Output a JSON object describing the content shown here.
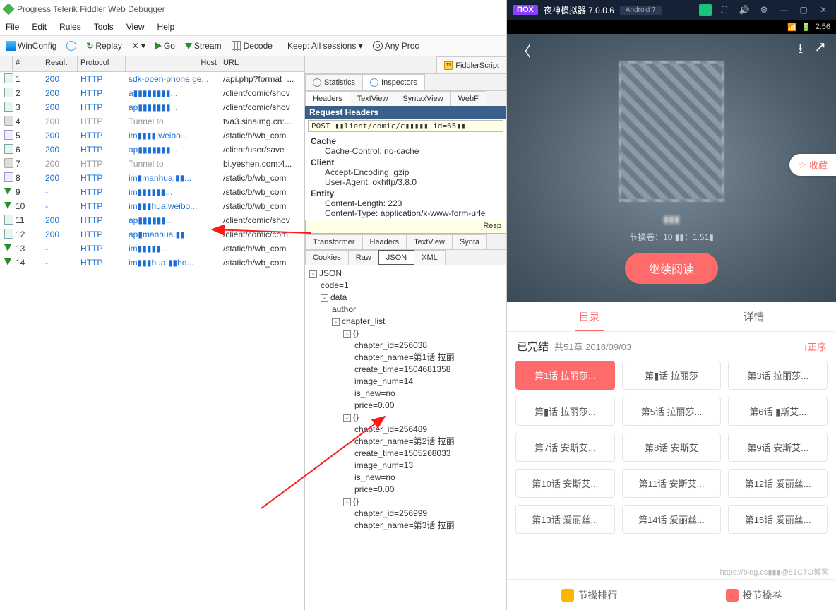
{
  "fiddler": {
    "title": "Progress Telerik Fiddler Web Debugger",
    "menu": [
      "File",
      "Edit",
      "Rules",
      "Tools",
      "View",
      "Help"
    ],
    "toolbar": {
      "winconfig": "WinConfig",
      "replay": "Replay",
      "x": "✕",
      "dd": "▾",
      "go": "Go",
      "stream": "Stream",
      "decode": "Decode",
      "keep": "Keep: All sessions ▾",
      "anyproc": "Any Proc"
    },
    "cols": {
      "id": "#",
      "result": "Result",
      "protocol": "Protocol",
      "host": "Host",
      "url": "URL"
    },
    "rows": [
      {
        "ic": "doc",
        "id": "1",
        "res": "200",
        "pro": "HTTP",
        "host": "sdk-open-phone.ge...",
        "url": "/api.php?format=...",
        "cls": ""
      },
      {
        "ic": "doc",
        "id": "2",
        "res": "200",
        "pro": "HTTP",
        "host": "a▮▮▮▮▮▮▮▮...",
        "url": "/client/comic/shov",
        "cls": ""
      },
      {
        "ic": "doc",
        "id": "3",
        "res": "200",
        "pro": "HTTP",
        "host": "ap▮▮▮▮▮▮▮...",
        "url": "/client/comic/shov",
        "cls": ""
      },
      {
        "ic": "lock",
        "id": "4",
        "res": "200",
        "pro": "HTTP",
        "host": "Tunnel to",
        "url": "tva3.sinaimg.cn:...",
        "cls": "gray"
      },
      {
        "ic": "page",
        "id": "5",
        "res": "200",
        "pro": "HTTP",
        "host": "im▮▮▮▮.weibo....",
        "url": "/static/b/wb_com",
        "cls": ""
      },
      {
        "ic": "doc",
        "id": "6",
        "res": "200",
        "pro": "HTTP",
        "host": "ap▮▮▮▮▮▮▮...",
        "url": "/client/user/save",
        "cls": ""
      },
      {
        "ic": "lock",
        "id": "7",
        "res": "200",
        "pro": "HTTP",
        "host": "Tunnel to",
        "url": "bi.yeshen.com:4...",
        "cls": "gray"
      },
      {
        "ic": "page",
        "id": "8",
        "res": "200",
        "pro": "HTTP",
        "host": "im▮manhua.▮▮...",
        "url": "/static/b/wb_com",
        "cls": ""
      },
      {
        "ic": "arr",
        "id": "9",
        "res": "-",
        "pro": "HTTP",
        "host": "im▮▮▮▮▮▮...",
        "url": "/static/b/wb_com",
        "cls": ""
      },
      {
        "ic": "arr",
        "id": "10",
        "res": "-",
        "pro": "HTTP",
        "host": "im▮▮▮hua.weibo...",
        "url": "/static/b/wb_com",
        "cls": ""
      },
      {
        "ic": "doc",
        "id": "11",
        "res": "200",
        "pro": "HTTP",
        "host": "ap▮▮▮▮▮▮...",
        "url": "/client/comic/shov",
        "cls": ""
      },
      {
        "ic": "doc",
        "id": "12",
        "res": "200",
        "pro": "HTTP",
        "host": "ap▮manhua.▮▮...",
        "url": "/client/comic/com",
        "cls": ""
      },
      {
        "ic": "arr",
        "id": "13",
        "res": "-",
        "pro": "HTTP",
        "host": "im▮▮▮▮▮...",
        "url": "/static/b/wb_com",
        "cls": ""
      },
      {
        "ic": "arr",
        "id": "14",
        "res": "-",
        "pro": "HTTP",
        "host": "im▮▮▮hua.▮▮ho...",
        "url": "/static/b/wb_com",
        "cls": ""
      }
    ],
    "topTabs": {
      "script": "FiddlerScript",
      "stats": "Statistics",
      "insp": "Inspectors"
    },
    "reqTabs": [
      "Headers",
      "TextView",
      "SyntaxView",
      "WebF"
    ],
    "reqTitle": "Request Headers",
    "reqLine": "POST ▮▮lient/comic/c▮▮▮▮▮ id=65▮▮",
    "headers": {
      "Cache": "Cache",
      "cache": "Cache-Control: no-cache",
      "Client": "Client",
      "ae": "Accept-Encoding: gzip",
      "ua": "User-Agent: okhttp/3.8.0",
      "Entity": "Entity",
      "cl": "Content-Length: 223",
      "ct": "Content-Type: application/x-www-form-urle"
    },
    "respLabel": "Resp",
    "respTabs": [
      "Transformer",
      "Headers",
      "TextView",
      "Synta"
    ],
    "respTabs2": [
      "Cookies",
      "Raw",
      "JSON",
      "XML"
    ],
    "json": {
      "root": "JSON",
      "code": "code=1",
      "data": "data",
      "author": "author",
      "chlist": "chapter_list",
      "ch": [
        {
          "id": "chapter_id=256038",
          "name": "chapter_name=第1话 拉丽",
          "ct": "create_time=1504681358",
          "img": "image_num=14",
          "new": "is_new=no",
          "price": "price=0.00"
        },
        {
          "id": "chapter_id=256489",
          "name": "chapter_name=第2话 拉丽",
          "ct": "create_time=1505268033",
          "img": "image_num=13",
          "new": "is_new=no",
          "price": "price=0.00"
        },
        {
          "id": "chapter_id=256999",
          "name": "chapter_name=第3话 拉丽"
        }
      ]
    }
  },
  "nox": {
    "brand": "ΠOX",
    "title": "夜神模拟器 7.0.0.6",
    "android": "Android 7",
    "time": "2:56",
    "fav": "收藏",
    "stats": "节操卷：10   ▮▮：1.51▮",
    "read": "继续阅读",
    "tabA": "目录",
    "tabB": "详情",
    "done": "已完结",
    "meta": "共51章 2018/09/03",
    "sort": "↓正序",
    "chips": [
      "第1话 拉丽莎...",
      "第▮话 拉丽莎",
      "第3话 拉丽莎...",
      "第▮话 拉丽莎...",
      "第5话 拉丽莎...",
      "第6话 ▮斯艾...",
      "第7话 安斯艾...",
      "第8话 安斯艾",
      "第9话 安斯艾...",
      "第10话 安斯艾...",
      "第11话 安斯艾...",
      "第12话 爱丽丝...",
      "第13话 爱丽丝...",
      "第14话 爱丽丝...",
      "第15话 爱丽丝..."
    ],
    "bot": {
      "rank": "节操排行",
      "vote": "投节操卷"
    },
    "wm": "https://blog.cs▮▮▮@51CTO博客"
  }
}
